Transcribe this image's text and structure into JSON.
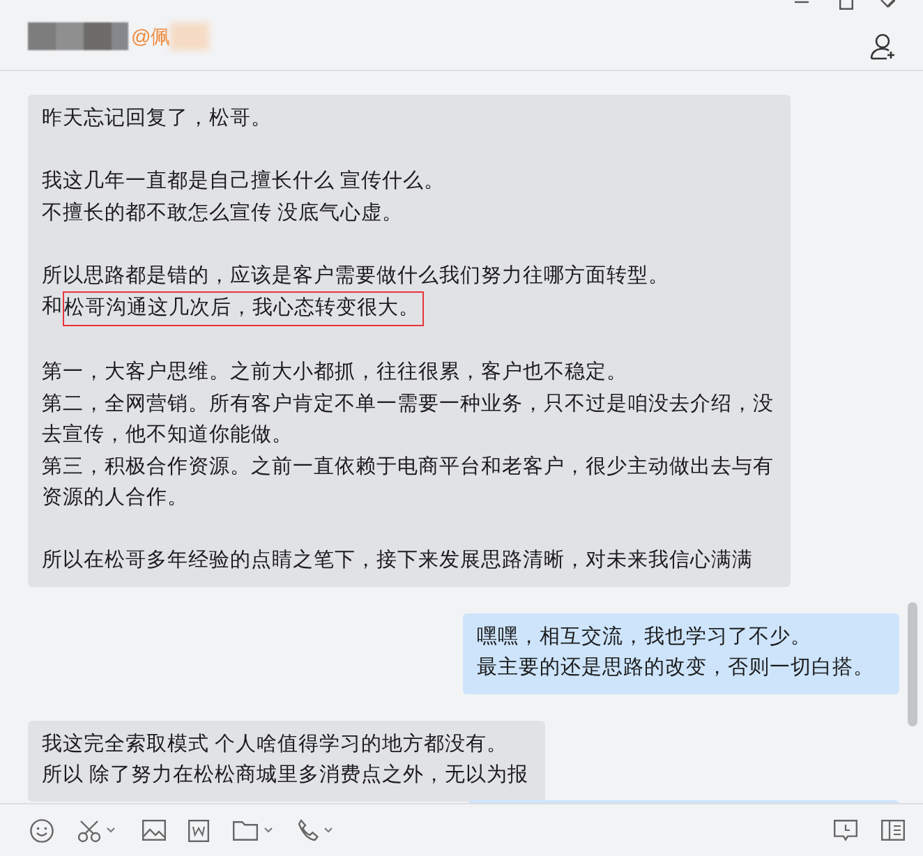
{
  "header": {
    "title": "@佩"
  },
  "messages": [
    {
      "kind": "incoming",
      "paragraphs": [
        [
          [
            {
              "text": "昨天忘记回复了，松哥。",
              "boxed": false
            }
          ]
        ],
        [
          [
            {
              "text": "我这几年一直都是自己擅长什么 宣传什么。",
              "boxed": false
            }
          ],
          [
            {
              "text": "不擅长的都不敢怎么宣传  没底气心虚。",
              "boxed": false
            }
          ]
        ],
        [
          [
            {
              "text": "所以思路都是错的，应该是客户需要做什么我们努力往哪方面转型。",
              "boxed": false
            }
          ],
          [
            {
              "text": "和",
              "boxed": false
            },
            {
              "text": "松哥沟通这几次后，我心态转变很大。",
              "boxed": true
            }
          ]
        ],
        [
          [
            {
              "text": "第一，大客户思维。之前大小都抓，往往很累，客户也不稳定。",
              "boxed": false
            }
          ],
          [
            {
              "text": "第二，全网营销。所有客户肯定不单一需要一种业务，只不过是咱没去介绍，没",
              "boxed": false
            }
          ],
          [
            {
              "text": "去宣传，他不知道你能做。",
              "boxed": false
            }
          ],
          [
            {
              "text": "第三，积极合作资源。之前一直依赖于电商平台和老客户，很少主动做出去与有",
              "boxed": false
            }
          ],
          [
            {
              "text": "资源的人合作。",
              "boxed": false
            }
          ]
        ],
        [
          [
            {
              "text": "所以在松哥多年经验的点睛之笔下，接下来发展思路清晰，对未来我信心满满",
              "boxed": false
            }
          ]
        ]
      ]
    },
    {
      "kind": "outgoing",
      "paragraphs": [
        [
          [
            {
              "text": "嘿嘿，相互交流，我也学习了不少。",
              "boxed": false
            }
          ],
          [
            {
              "text": "最主要的还是思路的改变，否则一切白搭。",
              "boxed": false
            }
          ]
        ]
      ]
    },
    {
      "kind": "incoming",
      "paragraphs": [
        [
          [
            {
              "text": "我这完全索取模式  个人啥值得学习的地方都没有。",
              "boxed": false
            }
          ],
          [
            {
              "text": "所以 除了努力在松松商城里多消费点之外，无以为报",
              "boxed": false
            }
          ]
        ]
      ]
    }
  ]
}
